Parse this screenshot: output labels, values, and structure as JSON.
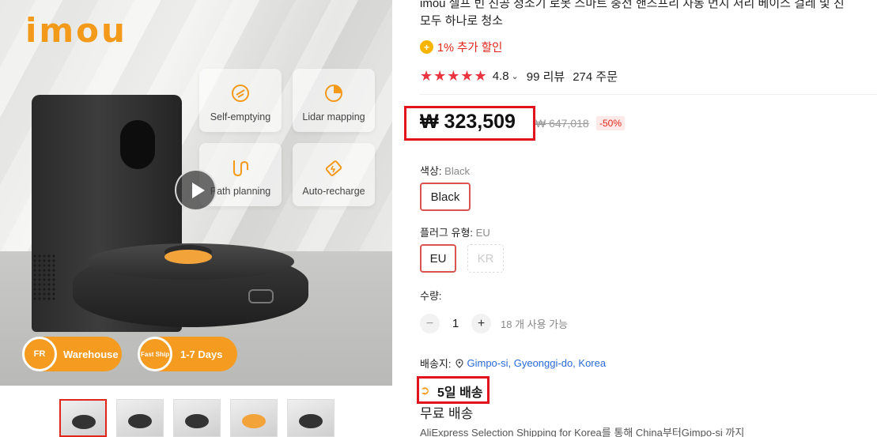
{
  "gallery": {
    "brand": "imou",
    "features": [
      {
        "label": "Self-emptying",
        "icon": "broom-icon"
      },
      {
        "label": "Lidar mapping",
        "icon": "radar-icon"
      },
      {
        "label": "Path planning",
        "icon": "path-icon"
      },
      {
        "label": "Auto-recharge",
        "icon": "battery-icon"
      }
    ],
    "badges": [
      {
        "circle": "FR",
        "label": "Warehouse"
      },
      {
        "circle": "Fast Ship",
        "label": "1-7 Days"
      }
    ],
    "thumbnail_count": 5
  },
  "product": {
    "title_line1": "imou 셀프 빈 진공 청소기 로봇 스마트 충전 핸즈프리 자동 먼지 처리 베이스 걸레 및 진",
    "title_line2": "모두 하나로 청소",
    "discount": "1% 추가 할인",
    "rating": "4.8",
    "reviews": "99 리뷰",
    "orders": "274 주문",
    "price": "₩ 323,509",
    "original_price": "₩ 647,018",
    "discount_pct": "-50%"
  },
  "options": {
    "color_label": "색상:",
    "color_value": "Black",
    "color_choices": [
      "Black"
    ],
    "plug_label": "플러그 유형:",
    "plug_value": "EU",
    "plug_choices": [
      "EU",
      "KR"
    ]
  },
  "quantity": {
    "label": "수량:",
    "minus": "−",
    "value": "1",
    "plus": "+",
    "available": "18 개 사용 가능"
  },
  "shipping": {
    "ship_to_label": "배송지:",
    "location": "Gimpo-si, Gyeonggi-do, Korea",
    "delivery_days": "5일 배송",
    "free_shipping": "무료 배송",
    "description": "AliExpress Selection Shipping for Korea를 통해 China부터Gimpo-si 까지"
  },
  "colors": {
    "accent_red": "#e1251b",
    "brand_orange": "#f49a1a",
    "link_blue": "#2a6ad8"
  }
}
